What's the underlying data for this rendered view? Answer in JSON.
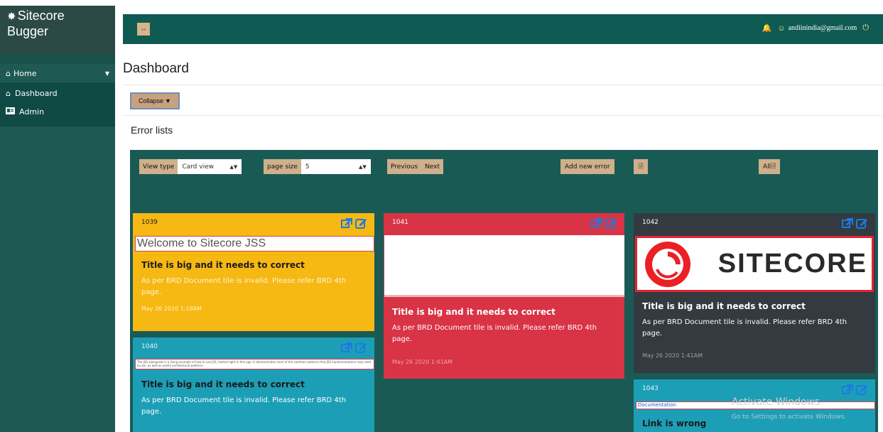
{
  "sidebar": {
    "brand_line1": "Sitecore",
    "brand_line2": "Bugger",
    "brand_icon": "bug-icon",
    "items": [
      {
        "label": "Home",
        "icon": "home-icon"
      },
      {
        "label": "Dashboard",
        "icon": "home-icon"
      },
      {
        "label": "Admin",
        "icon": "id-card-icon"
      }
    ]
  },
  "topbar": {
    "toggle_label": "↔",
    "email": "andiinindia@gmail.com",
    "icons": [
      "bell-icon",
      "user-circle-icon",
      "power-icon"
    ]
  },
  "page": {
    "title": "Dashboard",
    "collapse_label": "Collapse",
    "section_label": "Error lists"
  },
  "controls": {
    "view_type_label": "View type",
    "view_type_value": "Card view",
    "page_size_label": "page size",
    "page_size_value": "5",
    "previous_label": "Previous",
    "next_label": "Next",
    "add_label": "Add new error",
    "all_label": "All"
  },
  "cards": [
    {
      "id": "1039",
      "banner": "Welcome to Sitecore JSS",
      "title": "Title is big and it needs to correct",
      "desc": "As per BRD Document tile is invalid. Please refer BRD 4th page.",
      "date": "May 26 2020 1:18AM"
    },
    {
      "id": "1040",
      "banner": "The JSS styleguide is a living example of how to use JSS, hosted right in this app. It demonstrates most of the common patterns that JSS implementations may need to use, as well as useful architectural patterns.",
      "title": "Title is big and it needs to correct",
      "desc": "As per BRD Document tile is invalid. Please refer BRD 4th page."
    },
    {
      "id": "1041",
      "title": "Title is big and it needs to correct",
      "desc": "As per BRD Document tile is invalid. Please refer BRD 4th page.",
      "date": "May 26 2020 1:41AM"
    },
    {
      "id": "1042",
      "logo": "SITECORE",
      "title": "Title is big and it needs to correct",
      "desc": "As per BRD Document tile is invalid. Please refer BRD 4th page.",
      "date": "May 26 2020 1:41AM"
    },
    {
      "id": "1043",
      "banner": "Documentation",
      "title": "Link is wrong"
    }
  ],
  "watermark": {
    "line1": "Activate Windows",
    "line2": "Go to Settings to activate Windows."
  },
  "colors": {
    "sidebar": "#1f5a52",
    "topbar": "#0f5a52",
    "panel": "#1a5a55",
    "button": "#ceb08c",
    "card_yellow": "#f6b812",
    "card_red": "#d93346",
    "card_dark": "#333a40",
    "card_teal": "#1c9fb6",
    "action_icon": "#1f7ae0"
  }
}
